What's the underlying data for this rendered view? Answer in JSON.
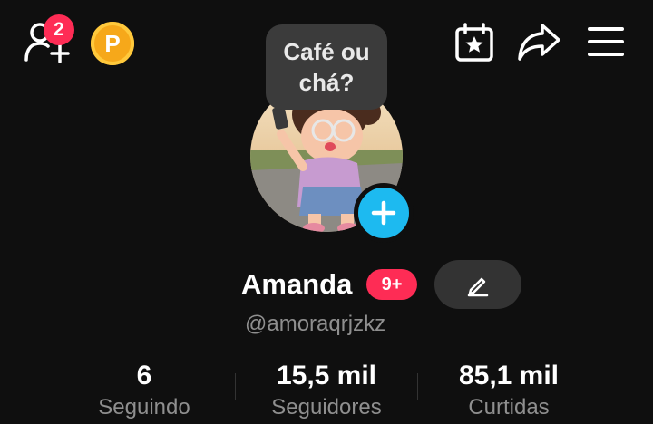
{
  "header": {
    "friend_requests_count": "2",
    "coin_letter": "P"
  },
  "note": {
    "text": "Café ou chá?"
  },
  "profile": {
    "name": "Amanda",
    "messages_badge": "9+",
    "username": "@amoraqrjzkz"
  },
  "stats": [
    {
      "value": "6",
      "label": "Seguindo"
    },
    {
      "value": "15,5 mil",
      "label": "Seguidores"
    },
    {
      "value": "85,1 mil",
      "label": "Curtidas"
    }
  ],
  "colors": {
    "background": "#0f0f0f",
    "badge_red": "#fe2c55",
    "add_photo_blue": "#1dbaf0",
    "coin_gold": "#f6a81a",
    "secondary_text": "#8f8f8f",
    "edit_button_bg": "#333333"
  },
  "icons": {
    "add_friends": "add-user-icon",
    "coin": "coin-icon",
    "calendar": "calendar-star-icon",
    "share": "share-arrow-icon",
    "menu": "hamburger-menu-icon",
    "add_photo": "plus-icon",
    "edit": "pencil-icon"
  }
}
